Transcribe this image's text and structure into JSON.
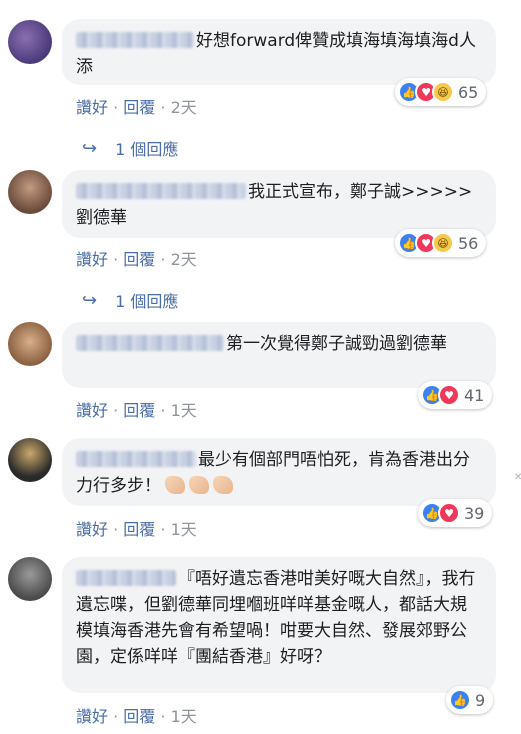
{
  "comments": [
    {
      "text": "好想forward俾贊成填海填海填海d人添",
      "like": "讚好",
      "dot": "·",
      "reply": "回覆",
      "time": "2天",
      "reaction_count": "65",
      "replies_label": "1 個回應",
      "avatar_color": "#5a4a8a"
    },
    {
      "text": "我正式宣布，鄭子誠>>>>>劉德華",
      "like": "讚好",
      "dot": "·",
      "reply": "回覆",
      "time": "2天",
      "reaction_count": "56",
      "replies_label": "1 個回應",
      "avatar_color": "#7a5a48"
    },
    {
      "text": "第一次覺得鄭子誠勁過劉德華",
      "like": "讚好",
      "dot": "·",
      "reply": "回覆",
      "time": "1天",
      "reaction_count": "41",
      "avatar_color": "#a07a5a"
    },
    {
      "text": "最少有個部門唔怕死，肯為香港出分力行多步！",
      "emoji": [
        "muscle-icon",
        "muscle-icon",
        "muscle-icon"
      ],
      "like": "讚好",
      "dot": "·",
      "reply": "回覆",
      "time": "1天",
      "reaction_count": "39",
      "avatar_color": "#3a3a3a"
    },
    {
      "text": "『唔好遺忘香港咁美好嘅大自然』，我冇遺忘喋，但劉德華同埋嗰班咩咩基金嘅人，都話大規模填海香港先會有希望喎！咁要大自然、發展郊野公園，定係咩咩『團結香港』好呀？",
      "like": "讚好",
      "dot": "·",
      "reply": "回覆",
      "time": "1天",
      "reaction_count": "9",
      "avatar_color": "#6a6a6a"
    }
  ],
  "colors": {
    "link": "#4b6ea8",
    "meta": "#90949c",
    "bubble": "#f2f3f5"
  }
}
